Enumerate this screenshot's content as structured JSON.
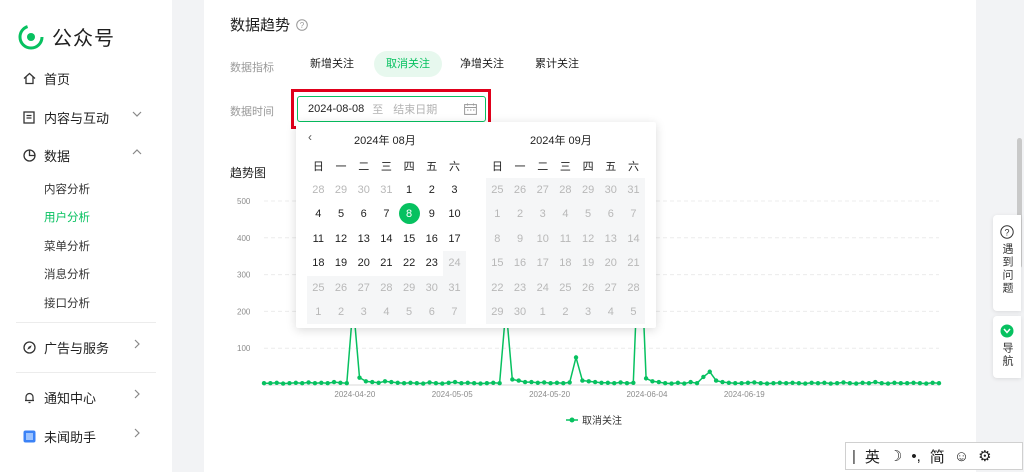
{
  "sidebar": {
    "logo_text": "公众号",
    "items": [
      {
        "label": "首页"
      },
      {
        "label": "内容与互动"
      },
      {
        "label": "数据"
      },
      {
        "label": "广告与服务"
      },
      {
        "label": "通知中心"
      },
      {
        "label": "未闻助手"
      }
    ],
    "data_sub_items": [
      {
        "label": "内容分析"
      },
      {
        "label": "用户分析",
        "active": true
      },
      {
        "label": "菜单分析"
      },
      {
        "label": "消息分析"
      },
      {
        "label": "接口分析"
      }
    ]
  },
  "main": {
    "title": "数据趋势",
    "metric_label": "数据指标",
    "metric_tabs": [
      "新增关注",
      "取消关注",
      "净增关注",
      "累计关注"
    ],
    "active_metric": "取消关注",
    "time_label": "数据时间",
    "date_start": "2024-08-08",
    "date_sep": "至",
    "date_end_placeholder": "结束日期",
    "chart_title": "趋势图"
  },
  "calendar": {
    "left_header": "2024年   08月",
    "right_header": "2024年   09月",
    "weekdays": [
      "日",
      "一",
      "二",
      "三",
      "四",
      "五",
      "六"
    ],
    "left_days": [
      "28",
      "29",
      "30",
      "31",
      "1",
      "2",
      "3",
      "4",
      "5",
      "6",
      "7",
      "8",
      "9",
      "10",
      "11",
      "12",
      "13",
      "14",
      "15",
      "16",
      "17",
      "18",
      "19",
      "20",
      "21",
      "22",
      "23",
      "24",
      "25",
      "26",
      "27",
      "28",
      "29",
      "30",
      "31",
      "1",
      "2",
      "3",
      "4",
      "5",
      "6",
      "7"
    ],
    "right_days": [
      "25",
      "26",
      "27",
      "28",
      "29",
      "30",
      "31",
      "1",
      "2",
      "3",
      "4",
      "5",
      "6",
      "7",
      "8",
      "9",
      "10",
      "11",
      "12",
      "13",
      "14",
      "15",
      "16",
      "17",
      "18",
      "19",
      "20",
      "21",
      "22",
      "23",
      "24",
      "25",
      "26",
      "27",
      "28",
      "29",
      "30",
      "1",
      "2",
      "3",
      "4",
      "5"
    ],
    "selected_day": "8"
  },
  "chart_data": {
    "type": "line",
    "title": "趋势图",
    "ylim": [
      0,
      500
    ],
    "yticks": [
      "500",
      "400",
      "300",
      "200",
      "100"
    ],
    "xticks": [
      "2024-04-20",
      "2024-05-05",
      "2024-05-20",
      "2024-06-04",
      "2024-06-19"
    ],
    "series": [
      {
        "name": "取消关注",
        "color": "#07c160",
        "values": [
          5,
          5,
          6,
          4,
          5,
          6,
          5,
          7,
          5,
          6,
          5,
          8,
          6,
          5,
          220,
          20,
          10,
          8,
          6,
          10,
          8,
          6,
          5,
          6,
          5,
          4,
          7,
          5,
          4,
          6,
          8,
          5,
          6,
          5,
          4,
          5,
          6,
          5,
          210,
          15,
          12,
          8,
          8,
          6,
          7,
          5,
          6,
          5,
          7,
          75,
          12,
          10,
          8,
          6,
          6,
          5,
          7,
          5,
          6,
          440,
          18,
          10,
          8,
          5,
          4,
          6,
          4,
          8,
          5,
          22,
          36,
          12,
          8,
          6,
          5,
          5,
          6,
          7,
          5,
          4,
          5,
          6,
          5,
          6,
          5,
          4,
          6,
          5,
          6,
          4,
          5,
          7,
          5,
          4,
          6,
          5,
          8,
          5,
          4,
          6,
          5,
          5,
          6,
          5,
          4,
          6,
          5
        ]
      }
    ],
    "legend": "bottom"
  },
  "float": {
    "help_label": "遇到问题",
    "nav_label": "导航"
  },
  "ime": [
    "英",
    "简"
  ],
  "colors": {
    "accent": "#07c160",
    "highlight": "#e0001b"
  }
}
